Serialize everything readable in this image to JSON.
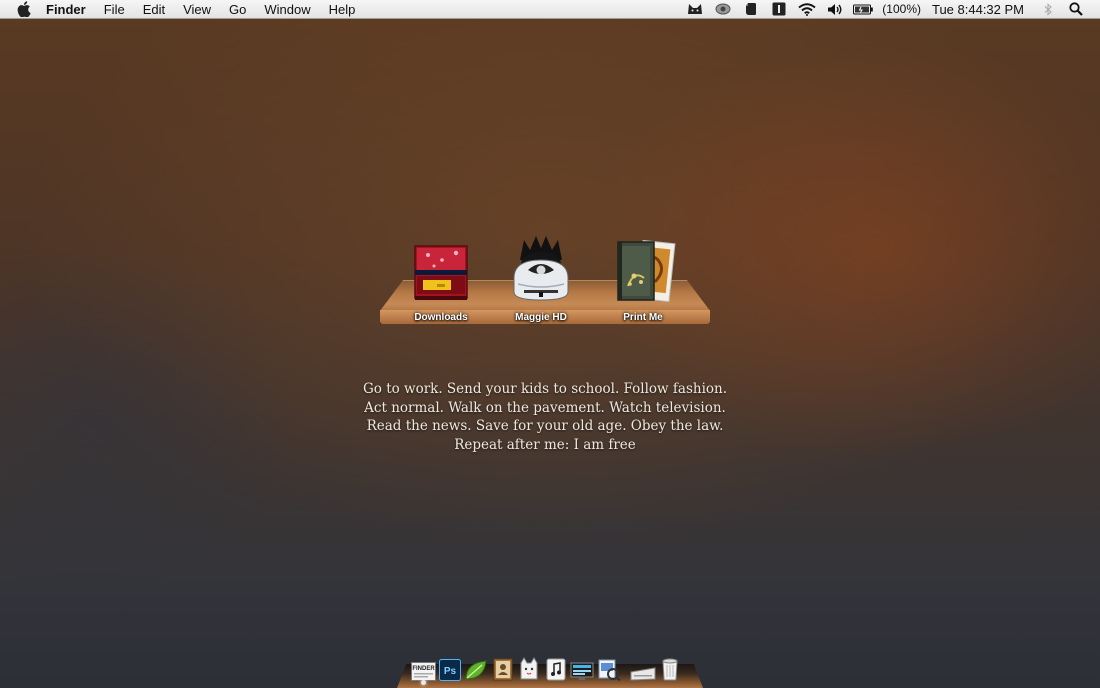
{
  "menubar": {
    "app_name": "Finder",
    "menus": [
      "File",
      "Edit",
      "View",
      "Go",
      "Window",
      "Help"
    ],
    "battery": "(100%)",
    "clock": "Tue 8:44:32 PM",
    "status_icons": [
      "cat-icon",
      "eye-icon",
      "evernote-icon",
      "one-password-icon",
      "wifi-icon",
      "volume-icon",
      "battery-icon",
      "bluetooth-icon",
      "spotlight-search-icon"
    ]
  },
  "shelf": {
    "items": [
      {
        "label": "Downloads",
        "icon": "downloads-box-icon"
      },
      {
        "label": "Maggie HD",
        "icon": "drive-icon"
      },
      {
        "label": "Print Me",
        "icon": "print-book-icon"
      }
    ]
  },
  "quote": {
    "lines": [
      "Go to work. Send your kids to school. Follow fashion.",
      "Act normal. Walk on the pavement. Watch television.",
      "Read the news. Save for your old age. Obey the law.",
      "Repeat after me: I am free"
    ]
  },
  "dock": {
    "finder_label": "FINDER",
    "items": [
      "finder-icon",
      "photoshop-icon",
      "leaf-icon",
      "address-book-icon",
      "cat-app-icon",
      "itunes-icon",
      "screen-icon",
      "preview-icon",
      "eject-tray-icon",
      "trash-icon"
    ]
  },
  "colors": {
    "menubar": "#ececec",
    "shelf_wood": "#b77a46",
    "quote_text": "#efe8de"
  }
}
